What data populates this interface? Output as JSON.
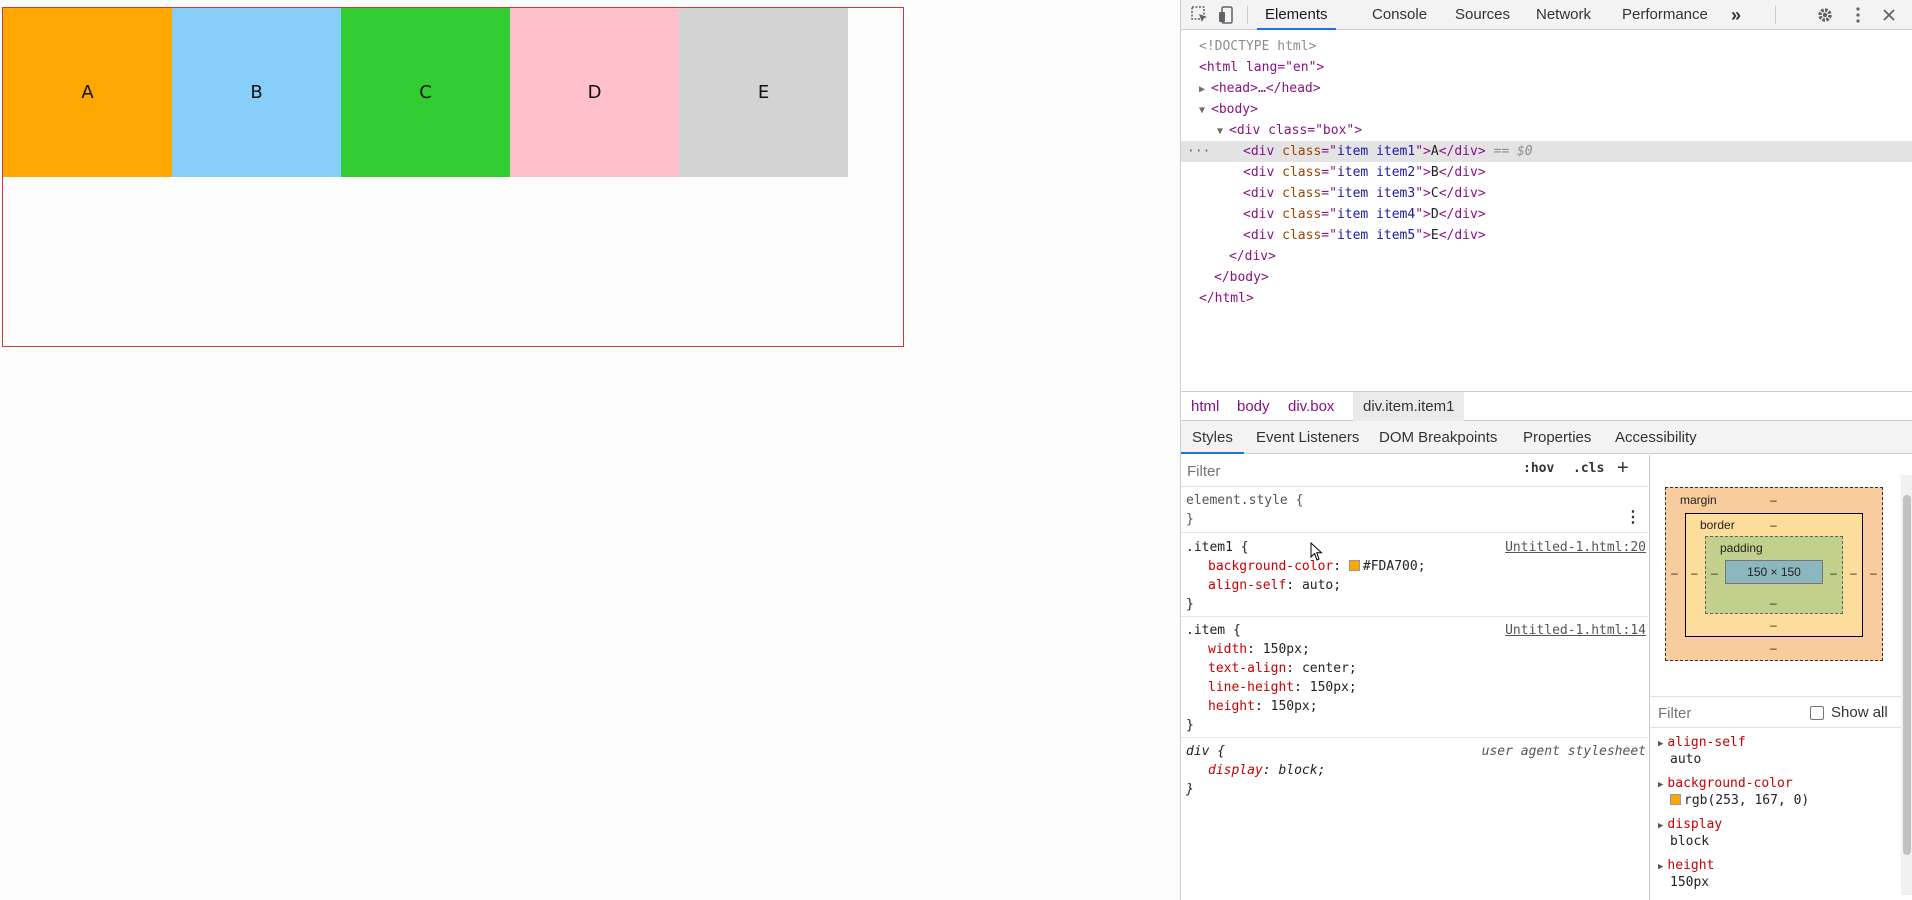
{
  "page": {
    "items": [
      {
        "label": "A",
        "color": "#FDA700"
      },
      {
        "label": "B",
        "color": "#87CEFA"
      },
      {
        "label": "C",
        "color": "#32CD32"
      },
      {
        "label": "D",
        "color": "#FFC0CB"
      },
      {
        "label": "E",
        "color": "#D3D3D3"
      }
    ]
  },
  "devtools": {
    "tabs": [
      "Elements",
      "Console",
      "Sources",
      "Network",
      "Performance"
    ],
    "more_tabs": "»",
    "dom": {
      "doctype": "<!DOCTYPE html>",
      "html_open": "<html lang=\"en\">",
      "head": "<head>…</head>",
      "body_open": "<body>",
      "box_open": "<div class=\"box\">",
      "items": [
        {
          "cls": "item item1",
          "text": "A"
        },
        {
          "cls": "item item2",
          "text": "B"
        },
        {
          "cls": "item item3",
          "text": "C"
        },
        {
          "cls": "item item4",
          "text": "D"
        },
        {
          "cls": "item item5",
          "text": "E"
        }
      ],
      "selected_suffix": " == $0",
      "div_close": "</div>",
      "body_close": "</body>",
      "html_close": "</html>"
    },
    "breadcrumbs": [
      "html",
      "body",
      "div.box",
      "div.item.item1"
    ],
    "subtabs": [
      "Styles",
      "Event Listeners",
      "DOM Breakpoints",
      "Properties",
      "Accessibility"
    ],
    "styles": {
      "filter_placeholder": "Filter",
      "hov": ":hov",
      "cls": ".cls",
      "add": "+",
      "element_style": "element.style {",
      "close_brace": "}",
      "rule1": {
        "selector": ".item1 {",
        "source": "Untitled-1.html:20",
        "bg_prop": "background-color",
        "bg_val": "#FDA700",
        "bg_color": "#FDA700",
        "align_prop": "align-self",
        "align_val": "auto"
      },
      "rule2": {
        "selector": ".item {",
        "source": "Untitled-1.html:14",
        "props": [
          {
            "name": "width",
            "value": "150px"
          },
          {
            "name": "text-align",
            "value": "center"
          },
          {
            "name": "line-height",
            "value": "150px"
          },
          {
            "name": "height",
            "value": "150px"
          }
        ]
      },
      "rule3": {
        "selector": "div {",
        "source": "user agent stylesheet",
        "prop": "display",
        "value": "block"
      }
    },
    "computed": {
      "margin_label": "margin",
      "border_label": "border",
      "padding_label": "padding",
      "dash": "–",
      "content_size": "150 × 150",
      "filter_placeholder": "Filter",
      "show_all": "Show all",
      "props": [
        {
          "name": "align-self",
          "value": "auto"
        },
        {
          "name": "background-color",
          "value": "rgb(253, 167, 0)",
          "swatch": "#FDA700"
        },
        {
          "name": "display",
          "value": "block"
        },
        {
          "name": "height",
          "value": "150px"
        }
      ]
    }
  }
}
